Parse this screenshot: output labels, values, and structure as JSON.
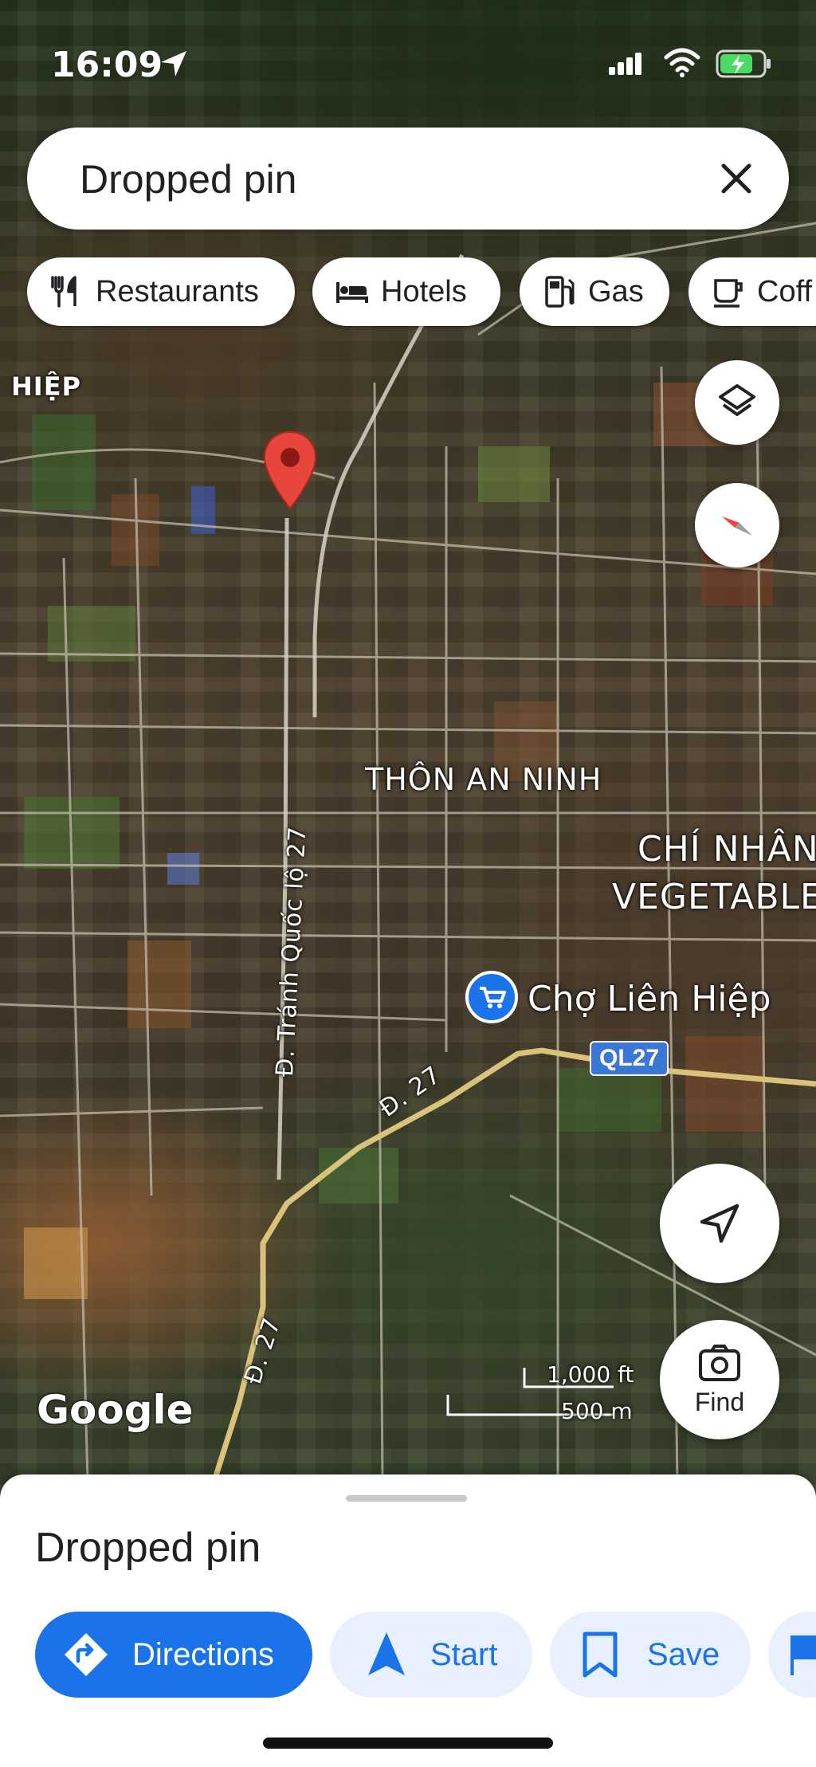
{
  "status_bar": {
    "time": "16:09"
  },
  "search": {
    "value": "Dropped pin",
    "close_icon": "close-icon"
  },
  "chips": [
    {
      "label": "Restaurants",
      "icon": "restaurant-icon"
    },
    {
      "label": "Hotels",
      "icon": "hotel-icon"
    },
    {
      "label": "Gas",
      "icon": "gas-icon"
    },
    {
      "label": "Coff",
      "icon": "coffee-icon"
    }
  ],
  "map": {
    "labels": {
      "area_left": "HIỆP",
      "thon_an_ninh": "THÔN AN NINH",
      "chi_nhan_1": "CHÍ NHÂN",
      "chi_nhan_2": "VEGETABLE",
      "road_tranh": "Đ. Tránh Quốc lộ 27",
      "road_27_a": "Đ. 27",
      "road_27_b": "Đ. 27",
      "market": "Chợ Liên Hiệp",
      "ql27": "QL27",
      "google": "Google"
    },
    "scale": {
      "imperial": "1,000 ft",
      "metric": "500 m"
    },
    "colors": {
      "road": "#d9c27a",
      "route_badge": "#3b78d6",
      "pin": "#e8453c",
      "market_pin": "#1a73e8"
    }
  },
  "controls": {
    "find_label": "Find"
  },
  "sheet": {
    "title": "Dropped pin",
    "actions": [
      {
        "label": "Directions",
        "icon": "directions-icon"
      },
      {
        "label": "Start",
        "icon": "navigation-arrow-icon"
      },
      {
        "label": "Save",
        "icon": "bookmark-icon"
      }
    ]
  },
  "colors": {
    "accent": "#1a73e8",
    "accent_light": "#e8f0fe"
  }
}
